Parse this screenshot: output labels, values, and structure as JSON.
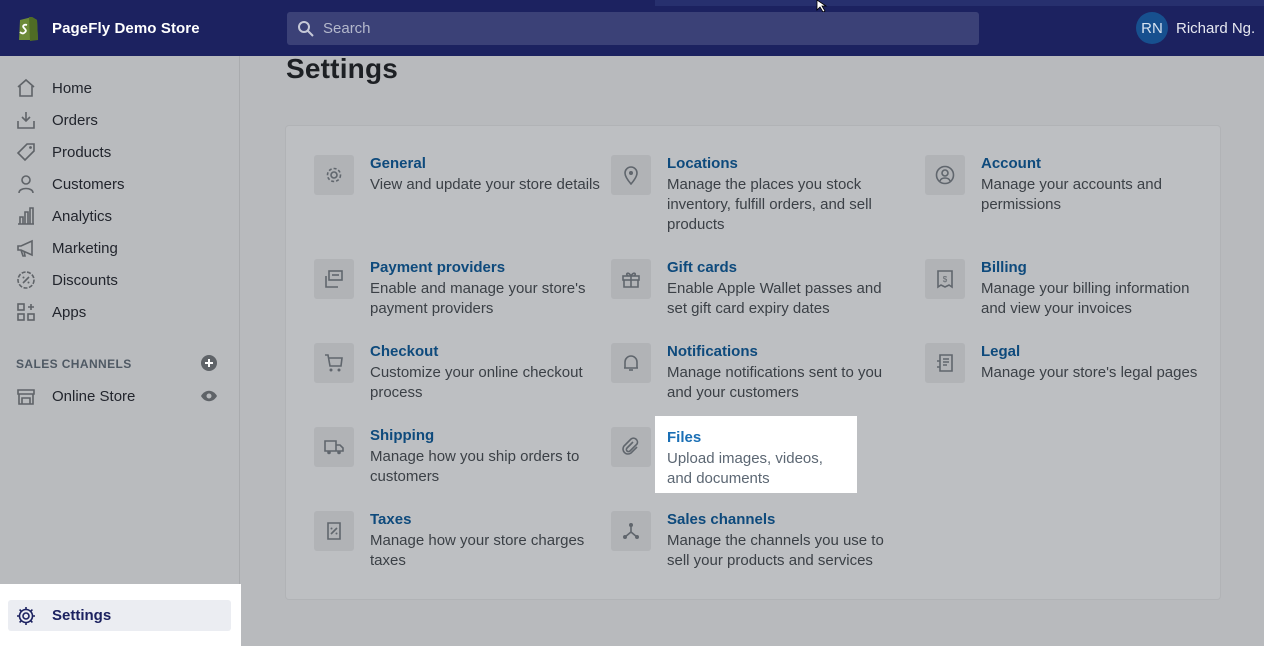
{
  "header": {
    "store_name": "PageFly Demo Store",
    "search_placeholder": "Search",
    "user_initials": "RN",
    "user_name": "Richard Ng."
  },
  "sidebar": {
    "items": [
      {
        "label": "Home",
        "icon": "home-icon"
      },
      {
        "label": "Orders",
        "icon": "orders-icon"
      },
      {
        "label": "Products",
        "icon": "tag-icon"
      },
      {
        "label": "Customers",
        "icon": "person-icon"
      },
      {
        "label": "Analytics",
        "icon": "bar-chart-icon"
      },
      {
        "label": "Marketing",
        "icon": "megaphone-icon"
      },
      {
        "label": "Discounts",
        "icon": "discount-icon"
      },
      {
        "label": "Apps",
        "icon": "apps-icon"
      }
    ],
    "sales_channels_title": "SALES CHANNELS",
    "channels": [
      {
        "label": "Online Store",
        "icon": "store-icon"
      }
    ],
    "settings_label": "Settings"
  },
  "main": {
    "title": "Settings",
    "tiles": [
      {
        "title": "General",
        "desc": "View and update your store details",
        "icon": "gear-icon"
      },
      {
        "title": "Locations",
        "desc": "Manage the places you stock inventory, fulfill orders, and sell products",
        "icon": "location-pin-icon"
      },
      {
        "title": "Account",
        "desc": "Manage your accounts and permissions",
        "icon": "account-icon"
      },
      {
        "title": "Payment providers",
        "desc": "Enable and manage your store's payment providers",
        "icon": "payment-icon"
      },
      {
        "title": "Gift cards",
        "desc": "Enable Apple Wallet passes and set gift card expiry dates",
        "icon": "gift-icon"
      },
      {
        "title": "Billing",
        "desc": "Manage your billing information and view your invoices",
        "icon": "billing-icon"
      },
      {
        "title": "Checkout",
        "desc": "Customize your online checkout process",
        "icon": "cart-icon"
      },
      {
        "title": "Notifications",
        "desc": "Manage notifications sent to you and your customers",
        "icon": "bell-icon"
      },
      {
        "title": "Legal",
        "desc": "Manage your store's legal pages",
        "icon": "legal-icon"
      },
      {
        "title": "Shipping",
        "desc": "Manage how you ship orders to customers",
        "icon": "truck-icon"
      },
      {
        "title": "Files",
        "desc": "Upload images, videos, and documents",
        "icon": "paperclip-icon"
      },
      {
        "title": "Taxes",
        "desc": "Manage how your store charges taxes",
        "icon": "tax-icon"
      },
      {
        "title": "Sales channels",
        "desc": "Manage the channels you use to sell your products and services",
        "icon": "channels-icon"
      }
    ]
  }
}
